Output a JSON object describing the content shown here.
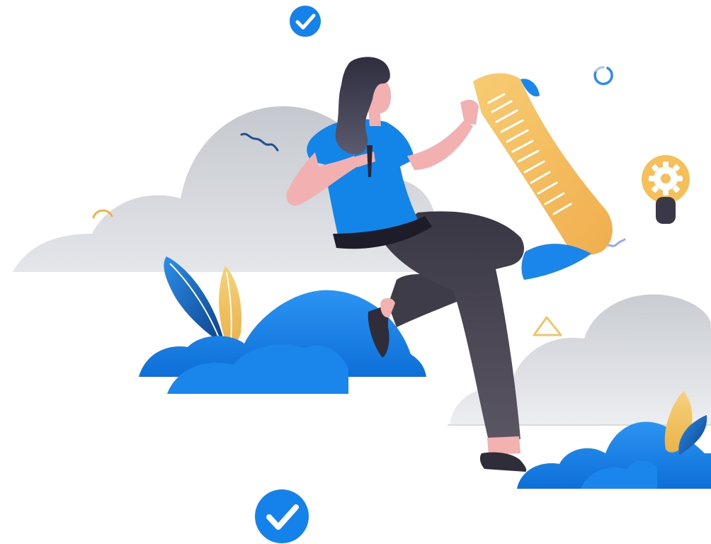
{
  "illustration": {
    "colors": {
      "background": "#ffffff",
      "cloud_gray": "#d3d6db",
      "brand_blue": "#1482ea",
      "dark_blue": "#0a4a9a",
      "scroll_yellow": "#f4c160",
      "hair_dark": "#3c3d4f",
      "skin": "#f2b0b0",
      "pants": "#4a4754",
      "shadow_dark": "#2a2636"
    },
    "icons": [
      "check-circle-icon",
      "refresh-ring-icon",
      "lightbulb-gear-icon",
      "triangle-outline-icon",
      "arc-outline-icon",
      "squiggle-icon"
    ]
  }
}
